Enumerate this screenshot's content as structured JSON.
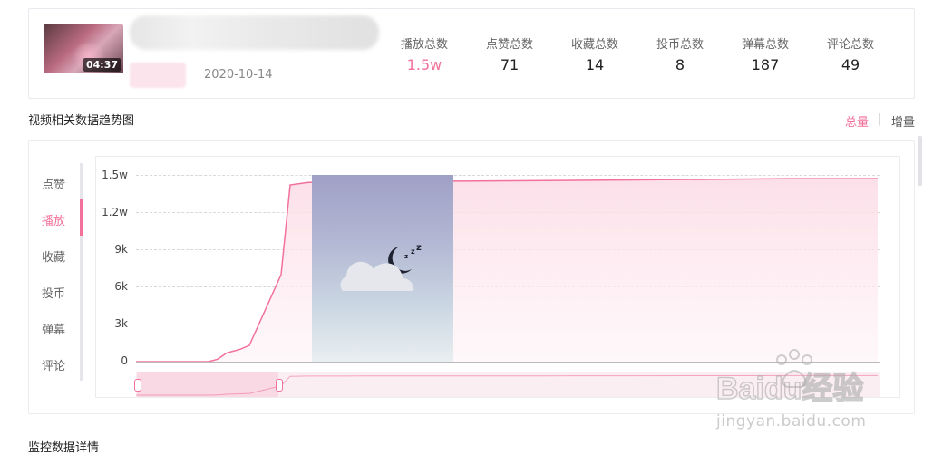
{
  "video": {
    "duration": "04:37",
    "publish_date": "2020-10-14"
  },
  "stats": [
    {
      "label": "播放总数",
      "value": "1.5w"
    },
    {
      "label": "点赞总数",
      "value": "71"
    },
    {
      "label": "收藏总数",
      "value": "14"
    },
    {
      "label": "投币总数",
      "value": "8"
    },
    {
      "label": "弹幕总数",
      "value": "187"
    },
    {
      "label": "评论总数",
      "value": "49"
    }
  ],
  "trend": {
    "section_title": "视频相关数据趋势图",
    "toggle_total": "总量",
    "toggle_separator": "|",
    "toggle_increment": "增量",
    "metrics": [
      "点赞",
      "播放",
      "收藏",
      "投币",
      "弹幕",
      "评论"
    ],
    "active_metric": "播放"
  },
  "chart_data": {
    "type": "area",
    "series": [
      {
        "values": [
          0,
          0,
          0,
          0,
          0,
          200,
          700,
          1000,
          1300,
          7000,
          14200,
          14400,
          14450,
          14500,
          14550,
          14600,
          14650,
          14700,
          14700,
          14700
        ]
      }
    ],
    "yticks": [
      "0",
      "3k",
      "6k",
      "9k",
      "1.2w",
      "1.5w"
    ],
    "ylim": [
      0,
      15000
    ],
    "grid": true,
    "line_color": "#f2719a",
    "fill_color": "#fde4ec"
  },
  "next_section_title": "监控数据详情",
  "watermark": {
    "logo_text": "Baidu经验",
    "url": "jingyan.baidu.com"
  }
}
